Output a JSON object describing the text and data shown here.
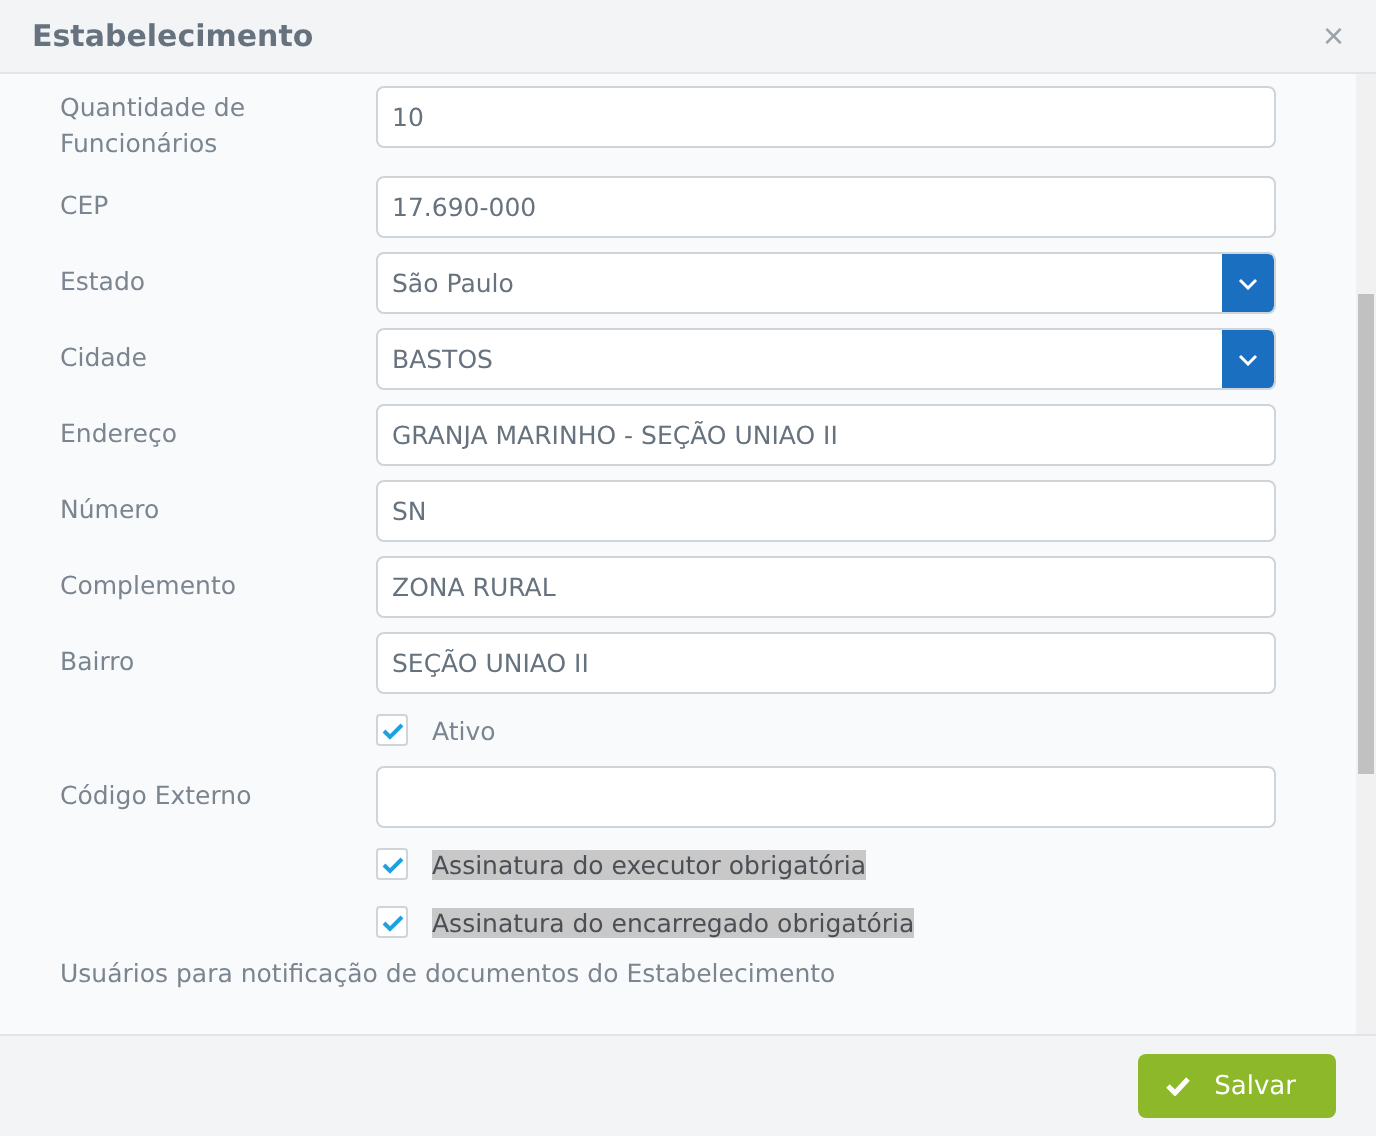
{
  "window": {
    "title": "Estabelecimento",
    "close": "×"
  },
  "form": [
    {
      "kind": "text",
      "label": "Quantidade de Funcionários",
      "value": "10"
    },
    {
      "kind": "text",
      "label": "CEP",
      "value": "17.690-000"
    },
    {
      "kind": "select",
      "label": "Estado",
      "value": "São Paulo"
    },
    {
      "kind": "select",
      "label": "Cidade",
      "value": "BASTOS"
    },
    {
      "kind": "text",
      "label": "Endereço",
      "value": "GRANJA MARINHO -  SEÇÃO UNIAO II"
    },
    {
      "kind": "text",
      "label": "Número",
      "value": "SN"
    },
    {
      "kind": "text",
      "label": "Complemento",
      "value": "ZONA RURAL"
    },
    {
      "kind": "text",
      "label": "Bairro",
      "value": "SEÇÃO UNIAO II"
    },
    {
      "kind": "checkbox",
      "label": "Ativo",
      "checked": true,
      "highlighted": false
    },
    {
      "kind": "text",
      "label": "Código Externo"
    },
    {
      "kind": "checkbox",
      "label": "Assinatura do executor obrigatória",
      "checked": true,
      "highlighted": true
    },
    {
      "kind": "checkbox",
      "label": "Assinatura do encarregado obrigatória",
      "checked": true,
      "highlighted": true
    },
    {
      "kind": "heading",
      "label": "Usuários para notificação de documentos do Estabelecimento"
    }
  ],
  "footer": {
    "save_button": "Salvar"
  }
}
